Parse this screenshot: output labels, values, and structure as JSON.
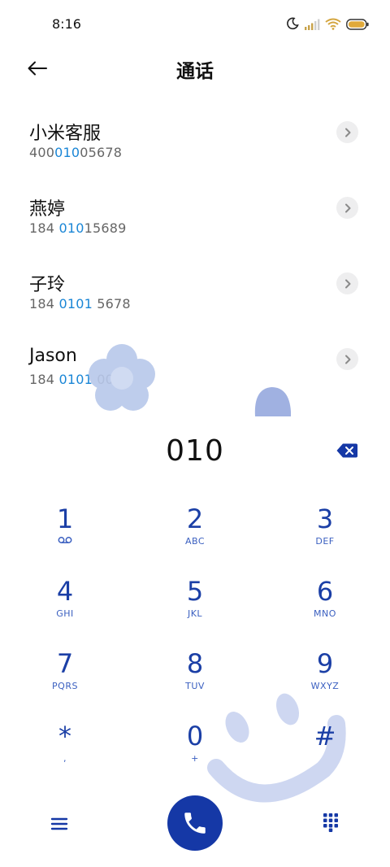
{
  "status_bar": {
    "time": "8:16",
    "icons": [
      "moon-icon",
      "signal-icon",
      "wifi-icon",
      "battery-icon"
    ]
  },
  "header": {
    "title": "通话"
  },
  "results": [
    {
      "name": "小米客服",
      "number_parts": [
        {
          "text": "400",
          "hl": false
        },
        {
          "text": "010",
          "hl": true
        },
        {
          "text": "05678",
          "hl": false
        }
      ]
    },
    {
      "name": "燕婷",
      "number_parts": [
        {
          "text": "184 ",
          "hl": false
        },
        {
          "text": "010",
          "hl": true
        },
        {
          "text": "15689",
          "hl": false
        }
      ]
    },
    {
      "name": "子玲",
      "number_parts": [
        {
          "text": "184 ",
          "hl": false
        },
        {
          "text": "0101",
          "hl": true
        },
        {
          "text": " 5678",
          "hl": false
        }
      ]
    },
    {
      "name": "Jason",
      "number_parts": [
        {
          "text": "184 ",
          "hl": false
        },
        {
          "text": "0101",
          "hl": true
        },
        {
          "text": " 0029",
          "hl": false
        }
      ]
    }
  ],
  "dialer": {
    "number": "010"
  },
  "keypad": [
    {
      "digit": "1",
      "letters": "",
      "icon": "voicemail-icon"
    },
    {
      "digit": "2",
      "letters": "ABC"
    },
    {
      "digit": "3",
      "letters": "DEF"
    },
    {
      "digit": "4",
      "letters": "GHI"
    },
    {
      "digit": "5",
      "letters": "JKL"
    },
    {
      "digit": "6",
      "letters": "MNO"
    },
    {
      "digit": "7",
      "letters": "PQRS"
    },
    {
      "digit": "8",
      "letters": "TUV"
    },
    {
      "digit": "9",
      "letters": "WXYZ"
    },
    {
      "digit": "*",
      "letters": ","
    },
    {
      "digit": "0",
      "letters": "+"
    },
    {
      "digit": "#",
      "letters": ""
    }
  ],
  "colors": {
    "accent": "#1538a6",
    "key_text": "#1b3fa6",
    "highlight": "#1a86d6",
    "decor": "#b8c6ea"
  }
}
